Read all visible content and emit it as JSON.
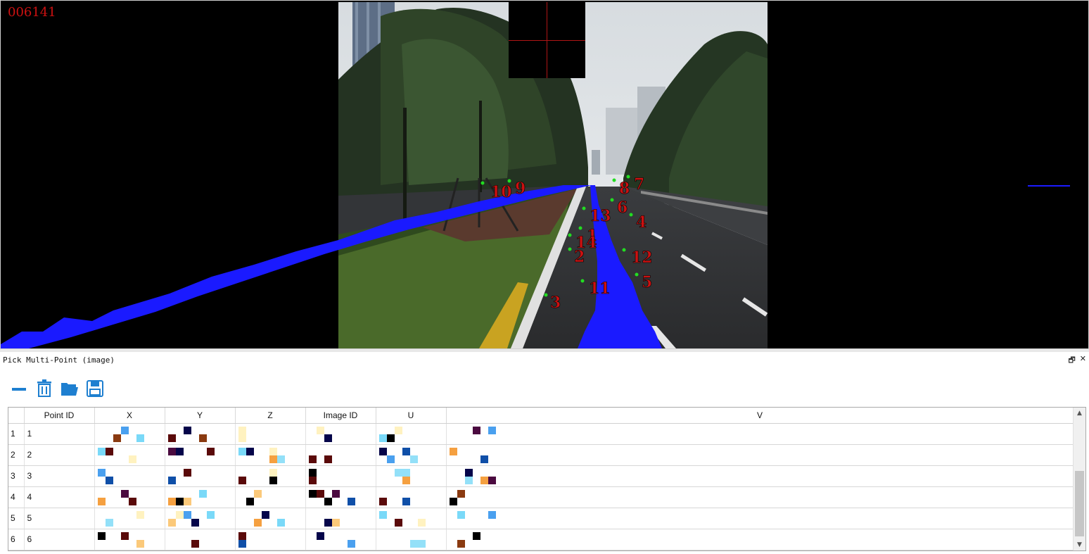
{
  "viewer": {
    "frame_id": "006141",
    "annotations": [
      {
        "label": "10"
      },
      {
        "label": "9"
      },
      {
        "label": "8"
      },
      {
        "label": "7"
      },
      {
        "label": "6"
      },
      {
        "label": "13"
      },
      {
        "label": "4"
      },
      {
        "label": "1"
      },
      {
        "label": "14"
      },
      {
        "label": "2"
      },
      {
        "label": "12"
      },
      {
        "label": "5"
      },
      {
        "label": "11"
      },
      {
        "label": "3"
      }
    ],
    "colors": {
      "point_marker": "#22dd22",
      "point_label": "#cc1111",
      "trajectory": "#1a1aff",
      "crosshair": "#b01515"
    }
  },
  "panel": {
    "title": "Pick Multi-Point (image)",
    "restore_icon": "restore-icon",
    "close_icon": "close-icon",
    "toolbar": {
      "remove_icon": "minus-icon",
      "delete_icon": "trash-icon",
      "open_icon": "folder-open-icon",
      "save_icon": "save-icon"
    },
    "table": {
      "columns": [
        "Point ID",
        "X",
        "Y",
        "Z",
        "Image ID",
        "U",
        "V"
      ],
      "rows": [
        {
          "row": "1",
          "point_id": "1"
        },
        {
          "row": "2",
          "point_id": "2"
        },
        {
          "row": "3",
          "point_id": "3"
        },
        {
          "row": "4",
          "point_id": "4"
        },
        {
          "row": "5",
          "point_id": "5"
        },
        {
          "row": "6",
          "point_id": "6"
        }
      ]
    }
  }
}
